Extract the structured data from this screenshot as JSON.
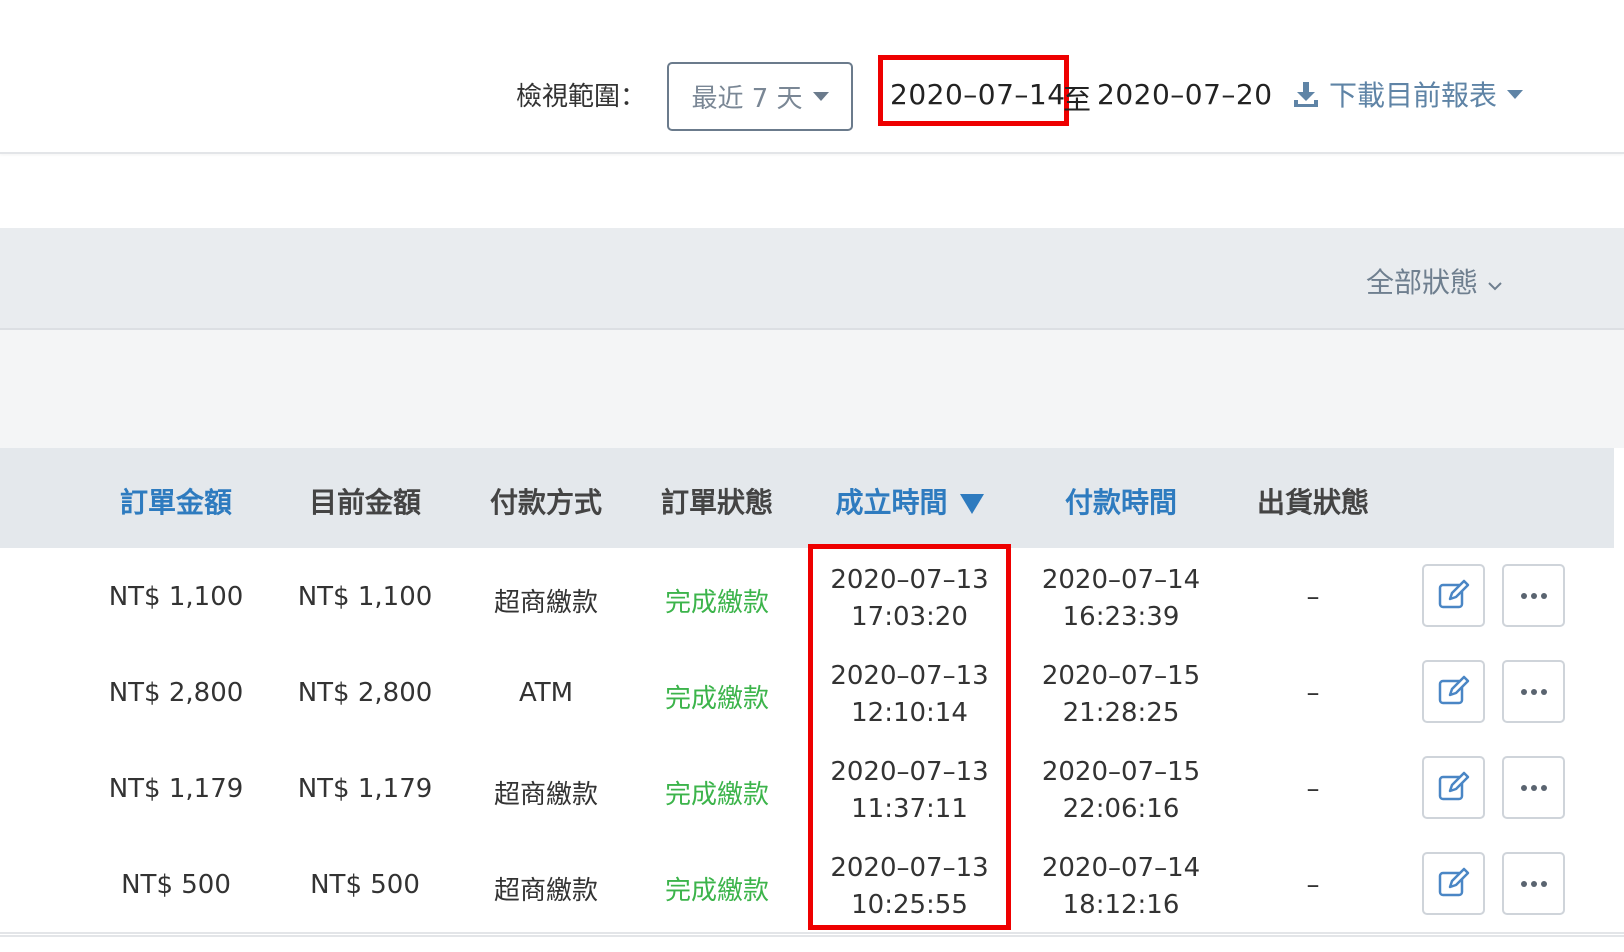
{
  "header": {
    "range_label": "檢視範圍：",
    "range_select": "最近 7 天",
    "date_start": "2020–07–14",
    "date_to": "至",
    "date_end": "2020–07–20",
    "download_label": "下載目前報表"
  },
  "filter": {
    "status_label": "全部狀態"
  },
  "table": {
    "columns": [
      "訂單金額",
      "目前金額",
      "付款方式",
      "訂單狀態",
      "成立時間",
      "付款時間",
      "出貨狀態"
    ],
    "rows": [
      {
        "amount": "NT$ 1,100",
        "current": "NT$ 1,100",
        "payment": "超商繳款",
        "status": "完成繳款",
        "created_date": "2020–07–13",
        "created_time": "17:03:20",
        "paid_date": "2020–07–14",
        "paid_time": "16:23:39",
        "shipping": "–"
      },
      {
        "amount": "NT$ 2,800",
        "current": "NT$ 2,800",
        "payment": "ATM",
        "status": "完成繳款",
        "created_date": "2020–07–13",
        "created_time": "12:10:14",
        "paid_date": "2020–07–15",
        "paid_time": "21:28:25",
        "shipping": "–"
      },
      {
        "amount": "NT$ 1,179",
        "current": "NT$ 1,179",
        "payment": "超商繳款",
        "status": "完成繳款",
        "created_date": "2020–07–13",
        "created_time": "11:37:11",
        "paid_date": "2020–07–15",
        "paid_time": "22:06:16",
        "shipping": "–"
      },
      {
        "amount": "NT$ 500",
        "current": "NT$ 500",
        "payment": "超商繳款",
        "status": "完成繳款",
        "created_date": "2020–07–13",
        "created_time": "10:25:55",
        "paid_date": "2020–07–14",
        "paid_time": "18:12:16",
        "shipping": "–"
      }
    ]
  },
  "colors": {
    "link_blue": "#2e7bbf",
    "success_green": "#3cb44b",
    "highlight_red": "#ee0000"
  },
  "icons": {
    "edit": "edit-icon",
    "more": "more-icon",
    "download": "download-icon"
  }
}
